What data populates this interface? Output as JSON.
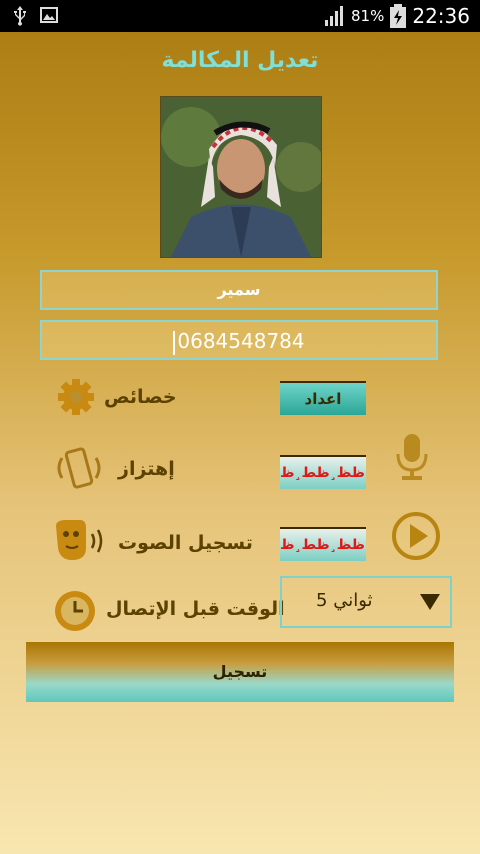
{
  "status_bar": {
    "usb_icon": "usb-icon",
    "gallery_icon": "image-icon",
    "signal_icon": "signal-icon",
    "battery_percent": "81%",
    "battery_icon": "battery-charging-icon",
    "time": "22:36"
  },
  "header": {
    "title": "تعديل المكالمة"
  },
  "contact": {
    "photo": "contact-photo",
    "name": "سمير",
    "phone": "0684548784"
  },
  "settings": [
    {
      "label": "خصائص",
      "icon": "gear-icon",
      "button": "اعداد"
    },
    {
      "label": "إهتزاز",
      "icon": "vibrate-phone-icon",
      "button": "ظ„ظظ¸ظط¸ظ„",
      "side_icon": "microphone-icon"
    },
    {
      "label": "تسجيل الصوت",
      "icon": "speaking-head-icon",
      "button": "ظ„ظظ¸ظط¸ظ„",
      "side_icon": "play-icon"
    },
    {
      "label": "الوقت قبل الإتصال",
      "icon": "clock-icon"
    }
  ],
  "delay_select": {
    "value": "5 ثواني"
  },
  "save_label": "تسجيل",
  "colors": {
    "accent_teal": "#5ec8bd",
    "title_text": "#7fe0d8",
    "label_text": "#5c4200",
    "error_red": "#e01818"
  }
}
